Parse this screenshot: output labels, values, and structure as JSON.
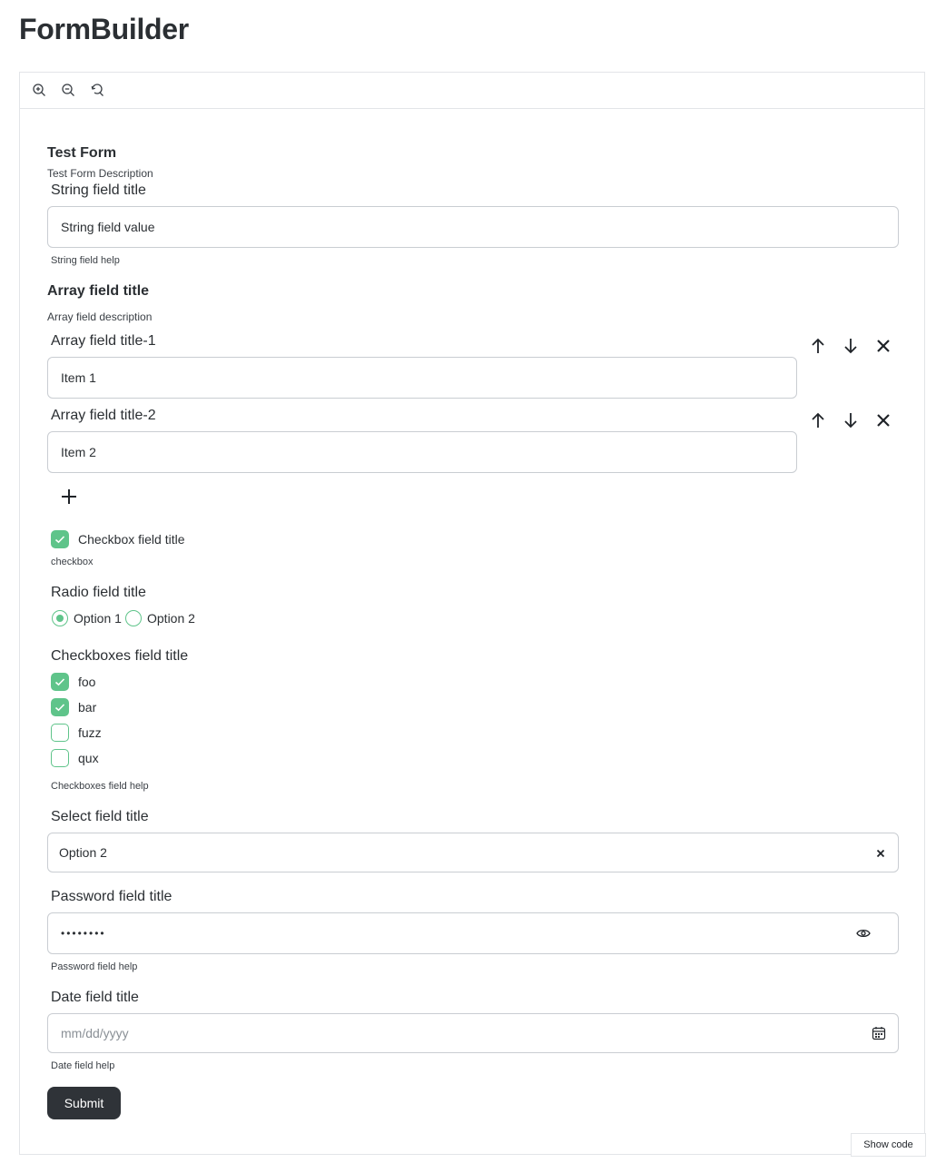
{
  "app": {
    "title": "FormBuilder"
  },
  "toolbar": {
    "zoom_in": "zoom-in-icon",
    "zoom_out": "zoom-out-icon",
    "reset": "reset-zoom-icon"
  },
  "form": {
    "title": "Test Form",
    "description": "Test Form Description",
    "string_field": {
      "title": "String field title",
      "value": "String field value",
      "help": "String field help"
    },
    "array_field": {
      "title": "Array field title",
      "description": "Array field description",
      "items": [
        {
          "title": "Array field title-1",
          "value": "Item 1"
        },
        {
          "title": "Array field title-2",
          "value": "Item 2"
        }
      ]
    },
    "checkbox_field": {
      "title": "Checkbox field title",
      "checked": true,
      "help": "checkbox"
    },
    "radio_field": {
      "title": "Radio field title",
      "options": [
        "Option 1",
        "Option 2"
      ],
      "selected": "Option 1"
    },
    "checkboxes_field": {
      "title": "Checkboxes field title",
      "options": [
        {
          "label": "foo",
          "checked": true
        },
        {
          "label": "bar",
          "checked": true
        },
        {
          "label": "fuzz",
          "checked": false
        },
        {
          "label": "qux",
          "checked": false
        }
      ],
      "help": "Checkboxes field help"
    },
    "select_field": {
      "title": "Select field title",
      "value": "Option 2"
    },
    "password_field": {
      "title": "Password field title",
      "value": "••••••••",
      "help": "Password field help"
    },
    "date_field": {
      "title": "Date field title",
      "placeholder": "mm/dd/yyyy",
      "help": "Date field help"
    },
    "submit_label": "Submit"
  },
  "show_code_label": "Show code",
  "colors": {
    "accent": "#5fc48a",
    "button_dark": "#2f3338",
    "border": "#c9cdd2"
  }
}
